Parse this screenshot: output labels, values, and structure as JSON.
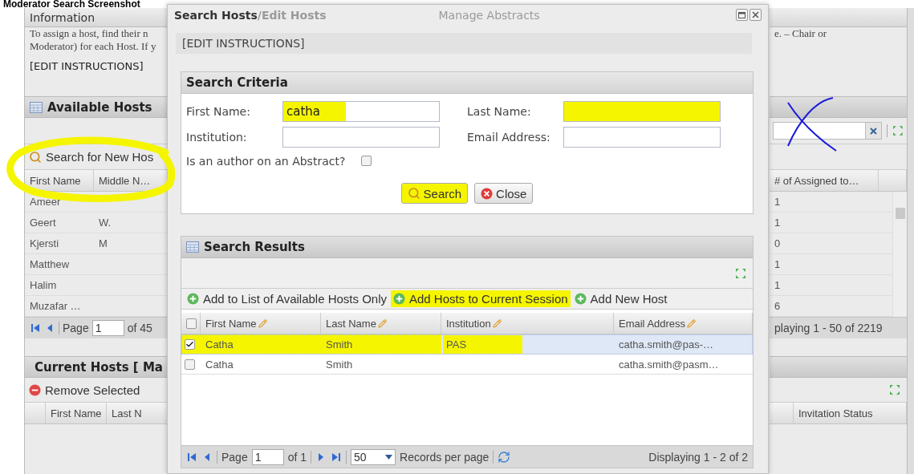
{
  "heading": "Moderator Search Screenshot",
  "background": {
    "tabs": [
      {
        "label": "Information",
        "selected": true
      }
    ],
    "instruction_lines": [
      "To assign a host, find their n",
      "Moderator) for each Host. If y"
    ],
    "instruction_tail": "e. – Chair or",
    "edit_instructions": "[EDIT INSTRUCTIONS]",
    "available_hosts": {
      "title": "Available Hosts",
      "search_button": "Search for New Hos",
      "columns": [
        "First Name",
        "Middle N…"
      ],
      "count_column": "# of Assigned to…",
      "rows": [
        {
          "first_name": "Ameer",
          "assigned": "1"
        },
        {
          "first_name": "Geert",
          "middle_name": "W.",
          "assigned": "1"
        },
        {
          "first_name": "Kjersti",
          "middle_name": "M",
          "assigned": "0"
        },
        {
          "first_name": "Matthew",
          "assigned": "1"
        },
        {
          "first_name": "Halim",
          "assigned": "1"
        },
        {
          "first_name": "Muzafar …",
          "assigned": "6"
        }
      ],
      "pager": {
        "page_label": "Page",
        "page": "1",
        "of": "of 45",
        "display": "playing 1 - 50 of 2219"
      }
    },
    "current_hosts": {
      "title": "Current Hosts [ Ma",
      "remove_button": "Remove Selected",
      "columns": [
        "First Name",
        "Last N"
      ],
      "status_column": "Invitation Status"
    }
  },
  "dialog": {
    "title": "Search Hosts",
    "ghost_tabs": [
      "/Edit Hosts",
      "Manage Abstracts"
    ],
    "instructions": "[EDIT INSTRUCTIONS]",
    "criteria": {
      "title": "Search Criteria",
      "fields": [
        {
          "label": "First Name:",
          "value": "catha",
          "highlighted": true
        },
        {
          "label": "Last Name:",
          "highlighted": true
        },
        {
          "label": "Institution:",
          "highlighted": false
        },
        {
          "label": "Email Address:",
          "highlighted": false
        }
      ],
      "author_label": "Is an author on an Abstract?",
      "author_checked": false,
      "buttons": [
        {
          "label": "Search",
          "kind": "search",
          "highlighted": true
        },
        {
          "label": "Close",
          "kind": "close",
          "highlighted": false
        }
      ]
    },
    "results": {
      "title": "Search Results",
      "actions": [
        {
          "label": "Add to List of Available Hosts Only",
          "highlighted": false
        },
        {
          "label": "Add Hosts to Current Session",
          "highlighted": true
        },
        {
          "label": "Add New Host",
          "highlighted": false
        }
      ],
      "columns": [
        "First Name",
        "Last Name",
        "Institution",
        "Email Address"
      ],
      "select_all_checked": false,
      "rows": [
        {
          "first_name": "Catha",
          "last_name": "Smith",
          "institution": "PAS",
          "email": "catha.smith@pas-…",
          "checked": true,
          "selected": true,
          "highlighted": true
        },
        {
          "first_name": "Catha",
          "last_name": "Smith",
          "email": "catha.smith@pasm…",
          "checked": false,
          "selected": false,
          "highlighted": false
        }
      ],
      "pager": {
        "page_label": "Page",
        "page": "1",
        "of": "of 1",
        "page_size": "50",
        "per_page": "Records per page",
        "display": "Displaying 1 - 2 of 2"
      }
    }
  },
  "annotations": [
    {
      "kind": "circle"
    },
    {
      "kind": "cross"
    }
  ]
}
